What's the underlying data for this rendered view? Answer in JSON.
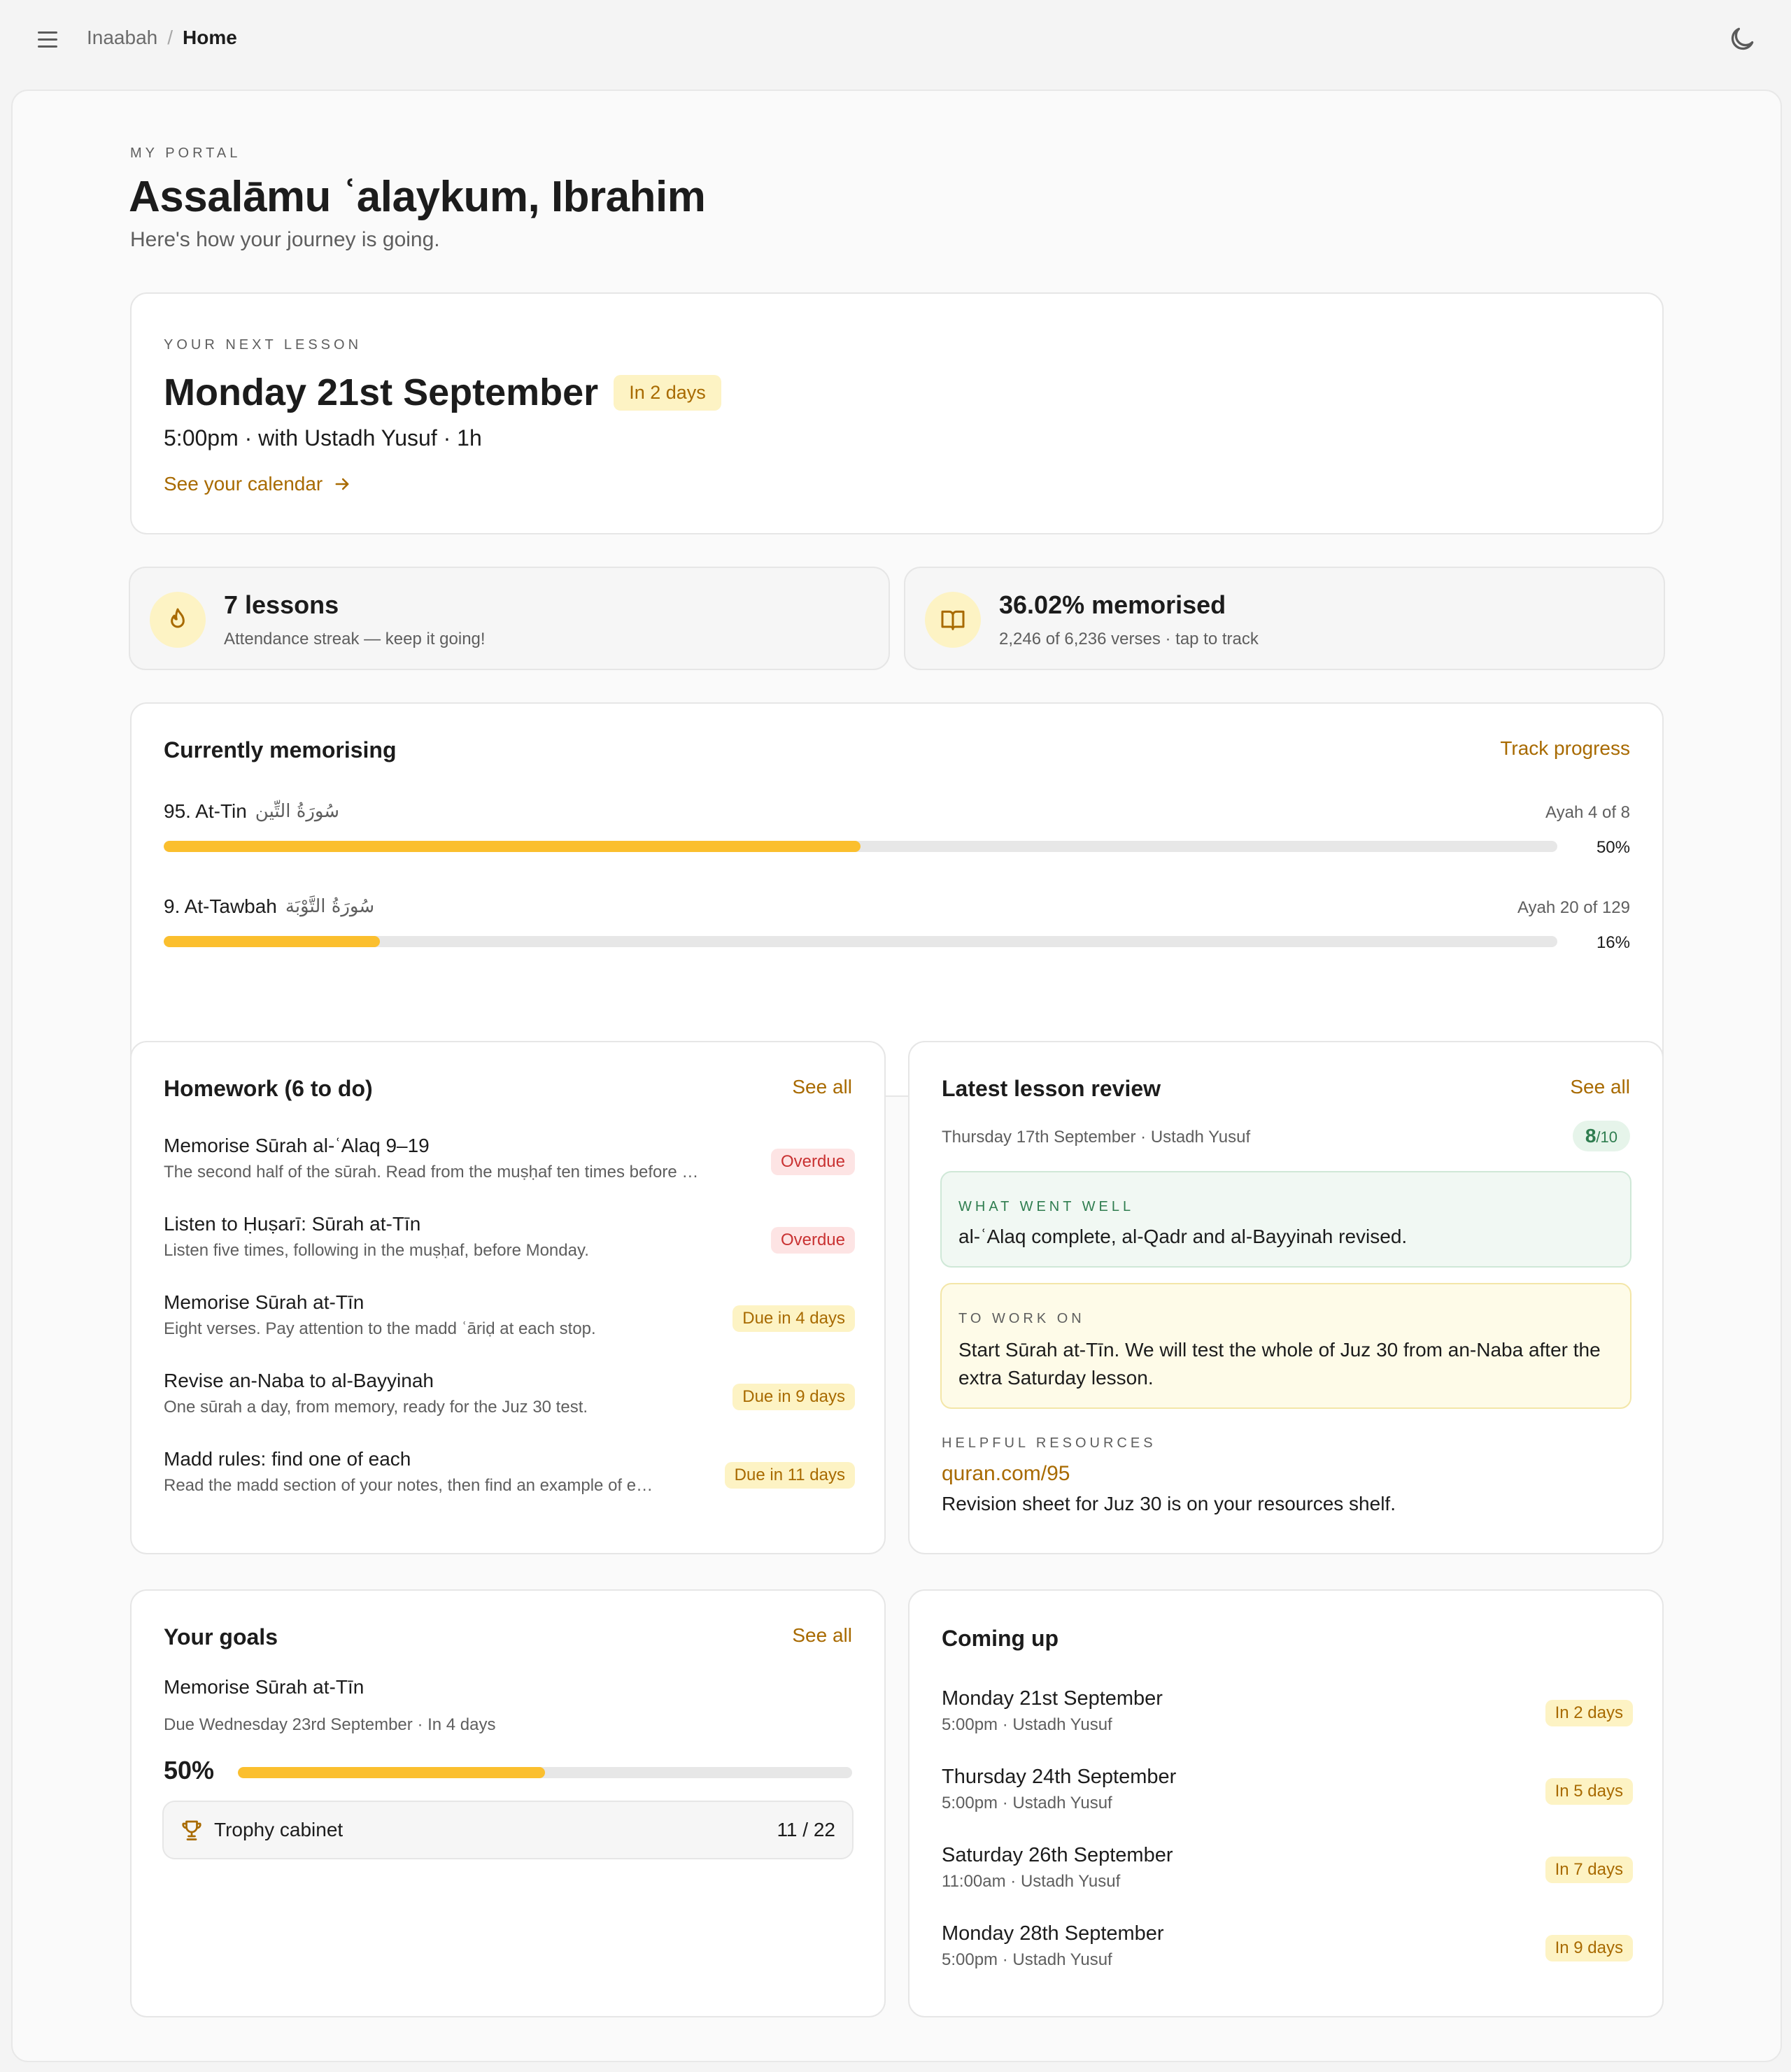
{
  "topbar": {
    "menu_icon": "menu-icon",
    "breadcrumb_root": "Inaabah",
    "breadcrumb_sep": "/",
    "breadcrumb_current": "Home",
    "theme_icon": "moon-icon"
  },
  "hero": {
    "eyebrow": "MY PORTAL",
    "greeting": "Assalāmu ʿalaykum, Ibrahim",
    "subtitle": "Here's how your journey is going."
  },
  "next_lesson": {
    "eyebrow": "YOUR NEXT LESSON",
    "date": "Monday 21st September",
    "badge": "In 2 days",
    "details": "5:00pm · with Ustadh Yusuf · 1h",
    "calendar_link": "See your calendar"
  },
  "stats": {
    "streak": {
      "icon": "flame-icon",
      "value": "7 lessons",
      "caption": "Attendance streak — keep it going!"
    },
    "memorised": {
      "icon": "book-open-icon",
      "value": "36.02% memorised",
      "caption": "2,246 of 6,236 verses · tap to track"
    }
  },
  "memorising": {
    "title": "Currently memorising",
    "link": "Track progress",
    "items": [
      {
        "name": "95. At-Tin",
        "arabic": "سُورَةُ التِّين",
        "ayah": "Ayah 4 of 8",
        "percent_label": "50%",
        "progress": 0.5
      },
      {
        "name": "9. At-Tawbah",
        "arabic": "سُورَةُ التَّوْبَة",
        "ayah": "Ayah 20 of 129",
        "percent_label": "16%",
        "progress": 0.155
      }
    ]
  },
  "homework": {
    "title": "Homework (6 to do)",
    "link": "See all",
    "items": [
      {
        "title": "Memorise Sūrah al-ʿAlaq 9–19",
        "desc": "The second half of the sūrah. Read from the muṣḥaf ten times before …",
        "badge": "Overdue",
        "status": "overdue"
      },
      {
        "title": "Listen to Ḥuṣarī: Sūrah at-Tīn",
        "desc": "Listen five times, following in the muṣḥaf, before Monday.",
        "badge": "Overdue",
        "status": "overdue"
      },
      {
        "title": "Memorise Sūrah at-Tīn",
        "desc": "Eight verses. Pay attention to the madd ʿāriḍ at each stop.",
        "badge": "Due in 4 days",
        "status": "due"
      },
      {
        "title": "Revise an-Naba to al-Bayyinah",
        "desc": "One sūrah a day, from memory, ready for the Juz 30 test.",
        "badge": "Due in 9 days",
        "status": "due"
      },
      {
        "title": "Madd rules: find one of each",
        "desc": "Read the madd section of your notes, then find an example of e…",
        "badge": "Due in 11 days",
        "status": "due"
      }
    ]
  },
  "review": {
    "title": "Latest lesson review",
    "link": "See all",
    "meta": "Thursday 17th September · Ustadh Yusuf",
    "score": "8",
    "score_total": "/10",
    "went_well_label": "WHAT WENT WELL",
    "went_well": "al-ʿAlaq complete, al-Qadr and al-Bayyinah revised.",
    "work_on_label": "TO WORK ON",
    "work_on": "Start Sūrah at-Tīn. We will test the whole of Juz 30 from an-Naba after the extra Saturday lesson.",
    "resources_label": "HELPFUL RESOURCES",
    "resource_link": "quran.com/95",
    "resource_note": "Revision sheet for Juz 30 is on your resources shelf."
  },
  "goals": {
    "title": "Your goals",
    "link": "See all",
    "goal_title": "Memorise Sūrah at-Tīn",
    "goal_meta": "Due Wednesday 23rd September · In 4 days",
    "percent_label": "50%",
    "progress": 0.5,
    "trophy_icon": "trophy-icon",
    "trophy_label": "Trophy cabinet",
    "trophy_count": "11 / 22"
  },
  "coming_up": {
    "title": "Coming up",
    "items": [
      {
        "date": "Monday 21st September",
        "meta": "5:00pm · Ustadh Yusuf",
        "badge": "In 2 days"
      },
      {
        "date": "Thursday 24th September",
        "meta": "5:00pm · Ustadh Yusuf",
        "badge": "In 5 days"
      },
      {
        "date": "Saturday 26th September",
        "meta": "11:00am · Ustadh Yusuf",
        "badge": "In 7 days"
      },
      {
        "date": "Monday 28th September",
        "meta": "5:00pm · Ustadh Yusuf",
        "badge": "In 9 days"
      }
    ]
  },
  "colors": {
    "accent": "#a86a00",
    "progress": "#fbbf2e",
    "badge_amber_bg": "#fdf3c4",
    "badge_red_bg": "#fde4e4",
    "success": "#2f7d4f"
  }
}
